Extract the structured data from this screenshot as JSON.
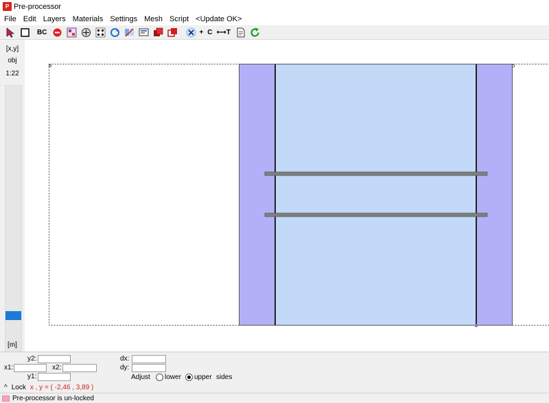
{
  "window": {
    "title": "Pre-processor",
    "app_icon_text": "P"
  },
  "menu": [
    "File",
    "Edit",
    "Layers",
    "Materials",
    "Settings",
    "Mesh",
    "Script",
    "<Update OK>"
  ],
  "toolbar": {
    "bc_label": "BC",
    "plus_label": "+",
    "c_label": "C",
    "t_label": "⟷T",
    "icons": [
      "select-arrow-icon",
      "rectangle-icon",
      "bc-text",
      "no-entry-icon",
      "grid-icon",
      "material-icon",
      "dots-icon",
      "rotate-icon",
      "mirror-icon",
      "screen-icon",
      "layers-icon",
      "copy-icon",
      "delete-x-icon",
      "page-icon",
      "refresh-icon"
    ]
  },
  "left_panel": {
    "xy_label": "[x,y]",
    "obj_label": "obj",
    "scale_label": "1:22",
    "unit_label": "[m]"
  },
  "slider_value_pct": 82,
  "inputs": {
    "y2_label": "y2:",
    "x1_label": "x1:",
    "x2_label": "x2:",
    "y1_label": "y1:",
    "dx_label": "dx:",
    "dy_label": "dy:",
    "y2": "",
    "x1": "",
    "x2": "",
    "y1": "",
    "dx": "",
    "dy": ""
  },
  "adjust": {
    "label": "Adjust",
    "lower_label": "lower",
    "upper_label": "upper",
    "sides_label": "sides",
    "selected": "upper"
  },
  "lock": {
    "caret": "^",
    "label": "Lock",
    "coords": "x , y = ( -2,46 , 3,89 )"
  },
  "status": {
    "text": "Pre-processor is un-locked"
  },
  "colors": {
    "side_layer": "#b2b1f7",
    "center_layer": "#c2d9f8",
    "beam": "#808080",
    "frame": "#555555",
    "accent": "#1e7ad6"
  }
}
